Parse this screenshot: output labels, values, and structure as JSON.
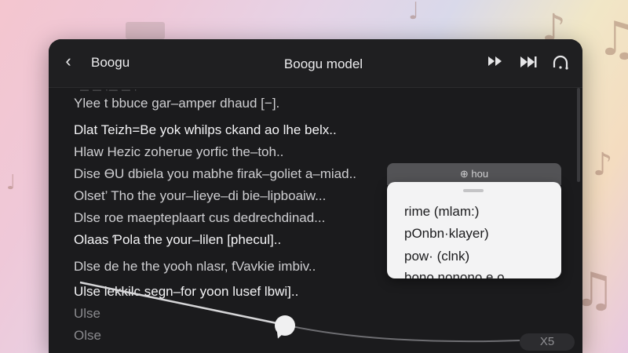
{
  "header": {
    "back_icon": "chevron-left-icon",
    "app_title": "Boogu",
    "window_title": "Boogu model",
    "icons": [
      "fast-forward-icon",
      "skip-forward-icon",
      "repeat-icon"
    ]
  },
  "ghost_line": "— — ·— — ·",
  "lines": [
    "Ylee t bbuce gar–amper dhaud [−].",
    "Dlat Teizh=Be yok whilps ckand ao lhe belx..",
    "Hlaw Hezic zoherue yorfic the–toh..",
    "Dise ƟU dbiela you mabhe firak–goliet a–miad..",
    "Olset’ Tho the your–lieye–di bie–lipboaiw...",
    "Dlse roe maepteplaart cus dedrechdinad...",
    "Olaas Ƥola the your–lilen [phecul]..",
    "Dlse de he the yooh nlasr, ƭVavkie imbiv..",
    "Ulse lekkilc segn–for yoon lusef lbwi]..",
    "Ulse",
    "Olse"
  ],
  "popover": {
    "header_label": "⊕ hou",
    "items": [
      "rime (mlam:)",
      "pOnbn·klayer)",
      "pow· (clnk)",
      "bono nonono e o"
    ]
  },
  "scrubber": {
    "speed_label": "X5",
    "position_fraction": 0.43
  },
  "colors": {
    "window_bg": "#1b1b1d",
    "popover_bg": "#f3f3f4",
    "text_primary": "#f4f4f6"
  }
}
